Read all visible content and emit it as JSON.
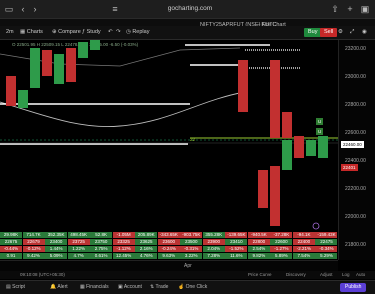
{
  "browser": {
    "url": "gocharting.com",
    "back_icon": "chevron-left-icon",
    "forward_icon": "chevron-right-icon",
    "tabs_icon": "tabs-icon",
    "share_icon": "share-icon",
    "reader_icon": "reader-icon"
  },
  "header": {
    "symbol": "NIFTY25APRFUT (NSE) FUTC",
    "chart_label": "- Kite Chart"
  },
  "toolbar": {
    "interval": "2m",
    "charts": "Charts",
    "compare": "Compare",
    "study": "Study",
    "replay": "Replay",
    "buy": "Buy",
    "sell": "Sell"
  },
  "ohlc": "O 22501.95  H 22509.15  L 22478.60  C 22495.00  -6.50 (-0.03%)",
  "price_axis": [
    "23200.00",
    "23000.00",
    "22800.00",
    "22600.00",
    "22400.00",
    "22200.00",
    "22000.00",
    "21800.00"
  ],
  "price_badges": {
    "current": "22460.00",
    "marker": "22401"
  },
  "stats": {
    "row1": [
      "29.98K",
      "714.7K",
      "352.35K",
      "498.45K",
      "52.8K",
      "-1.05M",
      "205.89K",
      "-343.65K",
      "-903.75K",
      "355.28K",
      "-139.65K",
      "-940.5K",
      "-37.28K",
      "-94.1K",
      "-159.43K"
    ],
    "row2": [
      "22675",
      "22679",
      "23400",
      "23725",
      "23750",
      "23325",
      "23625",
      "23600",
      "23500",
      "23900",
      "23410",
      "22800",
      "22600",
      "22400",
      "22475"
    ],
    "row3": [
      "-0.44%",
      "-0.12%",
      "1.44%",
      "1.22%",
      "2.75%",
      "-1.12%",
      "2.16%",
      "-0.24%",
      "-0.31%",
      "2.04%",
      "-1.52%",
      "2.54%",
      "-1.27%",
      "-2.21%",
      "-0.34%"
    ],
    "row4": [
      "0.91",
      "9.42%",
      "5.09%",
      "4.7%",
      "0.61%",
      "12.45%",
      "4.76%",
      "9.63%",
      "3.22%",
      "7.28%",
      "11.6%",
      "9.82%",
      "5.89%",
      "7.54%",
      "5.29%"
    ]
  },
  "date_axis": [
    "Apr"
  ],
  "status_left": "09:10:08 (UTC+05:30)",
  "status_right": [
    "Price Curve",
    "Discovery",
    "Adjust",
    "Log",
    "Auto"
  ],
  "tabs": [
    "Script",
    "Alert",
    "Financials",
    "Account",
    "Trade",
    "One Click",
    "Publish"
  ]
}
